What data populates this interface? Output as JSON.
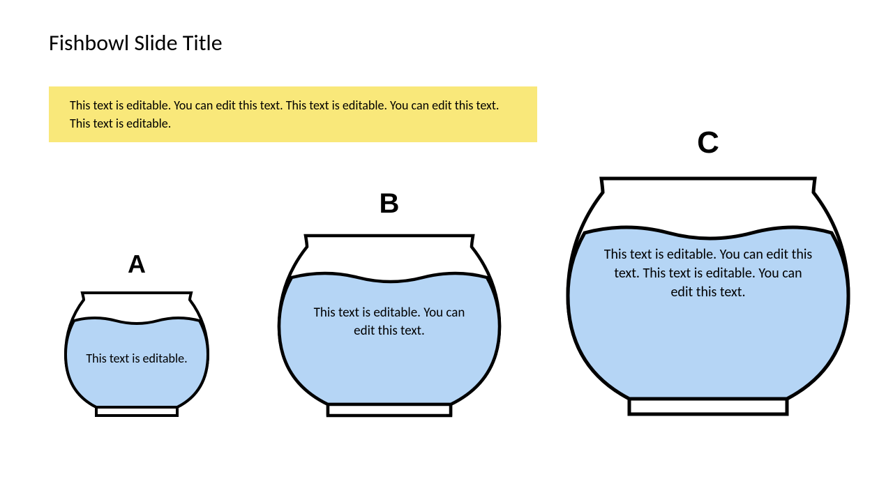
{
  "title": "Fishbowl Slide Title",
  "subtitle": "This text is editable. You can edit this text. This text is editable. You can edit this text. This text is editable.",
  "bowls": {
    "a": {
      "label": "A",
      "text": "This text is editable."
    },
    "b": {
      "label": "B",
      "text": "This text is editable. You can edit this text."
    },
    "c": {
      "label": "C",
      "text": "This text is editable. You can edit this text. This text is editable. You can edit this text."
    }
  },
  "colors": {
    "highlight": "#f9e87a",
    "water": "#b5d5f5",
    "outline": "#000000"
  }
}
